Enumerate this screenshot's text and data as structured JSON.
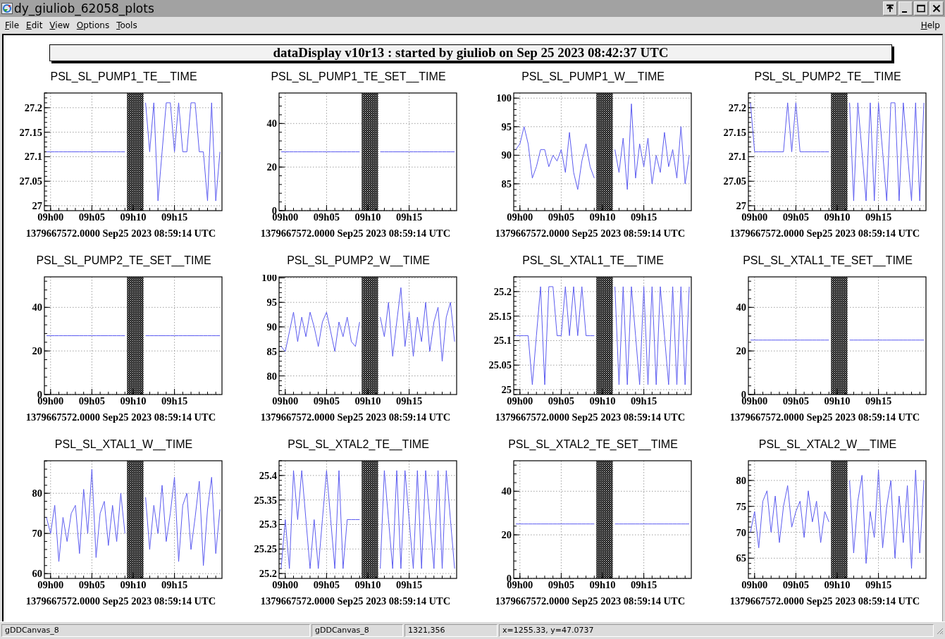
{
  "window": {
    "title": "dy_giuliob_62058_plots"
  },
  "menu": {
    "left": [
      "File",
      "Edit",
      "View",
      "Options",
      "Tools"
    ],
    "right": [
      "Help"
    ]
  },
  "header": "dataDisplay v10r13 : started by giuliob on Sep 25 2023 08:42:37 UTC",
  "plots": [
    {
      "chart_data": {
        "type": "line",
        "title": "PSL_SL_PUMP1_TE__TIME",
        "xlabel": "1379667572.0000 Sep25 2023 08:59:14 UTC",
        "ylim": [
          26.99,
          27.23
        ],
        "categories": [
          null,
          "09h00",
          null,
          null,
          null,
          null,
          null,
          null,
          null,
          null,
          null,
          "09h05",
          null,
          null,
          null,
          null,
          null,
          null,
          null,
          null,
          null,
          "09h10",
          null,
          null,
          null,
          null,
          null,
          null,
          null,
          null,
          null,
          "09h15",
          null,
          null,
          null,
          null,
          null,
          null,
          null,
          null,
          null,
          null,
          null
        ],
        "series": [
          {
            "color": "#5c5cf0",
            "values": [
              27.11,
              27.11,
              27.11,
              27.11,
              27.11,
              27.11,
              27.11,
              27.11,
              27.11,
              27.11,
              27.11,
              27.11,
              27.11,
              27.11,
              27.11,
              27.11,
              27.11,
              27.11,
              27.11,
              27.11,
              null,
              null,
              null,
              null,
              27.21,
              27.11,
              27.21,
              27.01,
              27.11,
              27.21,
              27.21,
              27.11,
              27.21,
              27.11,
              27.11,
              27.21,
              27.21,
              27.11,
              27.11,
              27.01,
              27.21,
              27.01,
              27.11
            ]
          }
        ],
        "yticks": [
          27,
          27.05,
          27.1,
          27.15,
          27.2
        ],
        "grid": true
      }
    },
    {
      "chart_data": {
        "type": "line",
        "title": "PSL_SL_PUMP1_TE_SET__TIME",
        "xlabel": "1379667572.0000 Sep25 2023 08:59:14 UTC",
        "ylim": [
          0,
          54
        ],
        "categories": [
          null,
          "09h00",
          null,
          null,
          null,
          null,
          null,
          null,
          null,
          null,
          null,
          "09h05",
          null,
          null,
          null,
          null,
          null,
          null,
          null,
          null,
          null,
          "09h10",
          null,
          null,
          null,
          null,
          null,
          null,
          null,
          null,
          null,
          "09h15",
          null,
          null,
          null,
          null,
          null,
          null,
          null,
          null,
          null,
          null,
          null
        ],
        "series": [
          {
            "color": "#5c5cf0",
            "values": [
              27,
              27,
              27,
              27,
              27,
              27,
              27,
              27,
              27,
              27,
              27,
              27,
              27,
              27,
              27,
              27,
              27,
              27,
              27,
              27,
              null,
              null,
              null,
              null,
              27,
              27,
              27,
              27,
              27,
              27,
              27,
              27,
              27,
              27,
              27,
              27,
              27,
              27,
              27,
              27,
              27,
              27,
              27
            ]
          }
        ],
        "yticks": [
          0,
          20,
          40
        ],
        "grid": true
      }
    },
    {
      "chart_data": {
        "type": "line",
        "title": "PSL_SL_PUMP1_W__TIME",
        "xlabel": "1379667572.0000 Sep25 2023 08:59:14 UTC",
        "ylim": [
          80.3,
          100.9
        ],
        "categories": [
          null,
          "09h00",
          null,
          null,
          null,
          null,
          null,
          null,
          null,
          null,
          null,
          "09h05",
          null,
          null,
          null,
          null,
          null,
          null,
          null,
          null,
          null,
          "09h10",
          null,
          null,
          null,
          null,
          null,
          null,
          null,
          null,
          null,
          "09h15",
          null,
          null,
          null,
          null,
          null,
          null,
          null,
          null,
          null,
          null,
          null
        ],
        "series": [
          {
            "color": "#5c5cf0",
            "values": [
              91,
              92,
              95,
              92,
              86,
              88,
              91,
              91,
              88,
              90,
              89,
              91,
              87,
              94,
              87,
              84,
              89,
              92,
              88,
              86,
              null,
              null,
              null,
              null,
              91,
              87,
              93,
              84,
              99,
              86,
              92,
              88,
              93,
              85,
              90,
              87,
              94,
              88,
              91,
              86,
              95,
              85,
              90
            ]
          }
        ],
        "yticks": [
          85,
          90,
          95,
          100
        ],
        "grid": true
      }
    },
    {
      "chart_data": {
        "type": "line",
        "title": "PSL_SL_PUMP2_TE__TIME",
        "xlabel": "1379667572.0000 Sep25 2023 08:59:14 UTC",
        "ylim": [
          26.99,
          27.23
        ],
        "categories": [
          null,
          "09h00",
          null,
          null,
          null,
          null,
          null,
          null,
          null,
          null,
          null,
          "09h05",
          null,
          null,
          null,
          null,
          null,
          null,
          null,
          null,
          null,
          "09h10",
          null,
          null,
          null,
          null,
          null,
          null,
          null,
          null,
          null,
          "09h15",
          null,
          null,
          null,
          null,
          null,
          null,
          null,
          null,
          null,
          null,
          null
        ],
        "series": [
          {
            "color": "#5c5cf0",
            "values": [
              27.21,
              27.11,
              27.11,
              27.11,
              27.11,
              27.11,
              27.11,
              27.11,
              27.11,
              27.21,
              27.11,
              27.21,
              27.11,
              27.11,
              27.11,
              27.11,
              27.11,
              27.11,
              27.11,
              27.11,
              null,
              null,
              null,
              null,
              27.21,
              27.01,
              27.21,
              27.11,
              27.01,
              27.21,
              27.01,
              27.21,
              27.11,
              27.01,
              27.21,
              27.21,
              27.01,
              27.21,
              27.11,
              27.01,
              27.21,
              27.01,
              27.21
            ]
          }
        ],
        "yticks": [
          27,
          27.05,
          27.1,
          27.15,
          27.2
        ],
        "grid": true
      }
    },
    {
      "chart_data": {
        "type": "line",
        "title": "PSL_SL_PUMP2_TE_SET__TIME",
        "xlabel": "1379667572.0000 Sep25 2023 08:59:14 UTC",
        "ylim": [
          0,
          54
        ],
        "categories": [
          null,
          "09h00",
          null,
          null,
          null,
          null,
          null,
          null,
          null,
          null,
          null,
          "09h05",
          null,
          null,
          null,
          null,
          null,
          null,
          null,
          null,
          null,
          "09h10",
          null,
          null,
          null,
          null,
          null,
          null,
          null,
          null,
          null,
          "09h15",
          null,
          null,
          null,
          null,
          null,
          null,
          null,
          null,
          null,
          null,
          null
        ],
        "series": [
          {
            "color": "#5c5cf0",
            "values": [
              27,
              27,
              27,
              27,
              27,
              27,
              27,
              27,
              27,
              27,
              27,
              27,
              27,
              27,
              27,
              27,
              27,
              27,
              27,
              27,
              null,
              null,
              null,
              null,
              27,
              27,
              27,
              27,
              27,
              27,
              27,
              27,
              27,
              27,
              27,
              27,
              27,
              27,
              27,
              27,
              27,
              27,
              27
            ]
          }
        ],
        "yticks": [
          0,
          20,
          40
        ],
        "grid": true
      }
    },
    {
      "chart_data": {
        "type": "line",
        "title": "PSL_SL_PUMP2_W__TIME",
        "xlabel": "1379667572.0000 Sep25 2023 08:59:14 UTC",
        "ylim": [
          76.2,
          100.2
        ],
        "categories": [
          null,
          "09h00",
          null,
          null,
          null,
          null,
          null,
          null,
          null,
          null,
          null,
          "09h05",
          null,
          null,
          null,
          null,
          null,
          null,
          null,
          null,
          null,
          "09h10",
          null,
          null,
          null,
          null,
          null,
          null,
          null,
          null,
          null,
          "09h15",
          null,
          null,
          null,
          null,
          null,
          null,
          null,
          null,
          null,
          null,
          null
        ],
        "series": [
          {
            "color": "#5c5cf0",
            "values": [
              86,
              85,
              89,
              93,
              87,
              92,
              88,
              93,
              90,
              86,
              91,
              93,
              89,
              85,
              91,
              88,
              92,
              87,
              86,
              91,
              null,
              null,
              null,
              null,
              92,
              88,
              95,
              84,
              91,
              98,
              86,
              93,
              84,
              92,
              87,
              95,
              85,
              91,
              94,
              83,
              92,
              95,
              87
            ]
          }
        ],
        "yticks": [
          80,
          85,
          90,
          95,
          100
        ],
        "grid": true
      }
    },
    {
      "chart_data": {
        "type": "line",
        "title": "PSL_SL_XTAL1_TE__TIME",
        "xlabel": "1379667572.0000 Sep25 2023 08:59:14 UTC",
        "ylim": [
          24.99,
          25.23
        ],
        "categories": [
          null,
          "09h00",
          null,
          null,
          null,
          null,
          null,
          null,
          null,
          null,
          null,
          "09h05",
          null,
          null,
          null,
          null,
          null,
          null,
          null,
          null,
          null,
          "09h10",
          null,
          null,
          null,
          null,
          null,
          null,
          null,
          null,
          null,
          "09h15",
          null,
          null,
          null,
          null,
          null,
          null,
          null,
          null,
          null,
          null,
          null
        ],
        "series": [
          {
            "color": "#5c5cf0",
            "values": [
              25.11,
              25.11,
              25.11,
              25.11,
              25.01,
              25.11,
              25.21,
              25.01,
              25.21,
              25.21,
              25.11,
              25.11,
              25.21,
              25.11,
              25.21,
              25.11,
              25.21,
              25.11,
              25.11,
              25.11,
              null,
              null,
              null,
              null,
              25.21,
              25.01,
              25.21,
              25.01,
              25.21,
              25.11,
              25.01,
              25.21,
              25.01,
              25.21,
              25.01,
              25.21,
              25.11,
              25.01,
              25.21,
              25.01,
              25.21,
              25.01,
              25.21
            ]
          }
        ],
        "yticks": [
          25,
          25.05,
          25.1,
          25.15,
          25.2
        ],
        "grid": true
      }
    },
    {
      "chart_data": {
        "type": "line",
        "title": "PSL_SL_XTAL1_TE_SET__TIME",
        "xlabel": "1379667572.0000 Sep25 2023 08:59:14 UTC",
        "ylim": [
          0,
          54
        ],
        "categories": [
          null,
          "09h00",
          null,
          null,
          null,
          null,
          null,
          null,
          null,
          null,
          null,
          "09h05",
          null,
          null,
          null,
          null,
          null,
          null,
          null,
          null,
          null,
          "09h10",
          null,
          null,
          null,
          null,
          null,
          null,
          null,
          null,
          null,
          "09h15",
          null,
          null,
          null,
          null,
          null,
          null,
          null,
          null,
          null,
          null,
          null
        ],
        "series": [
          {
            "color": "#5c5cf0",
            "values": [
              25,
              25,
              25,
              25,
              25,
              25,
              25,
              25,
              25,
              25,
              25,
              25,
              25,
              25,
              25,
              25,
              25,
              25,
              25,
              25,
              null,
              null,
              null,
              null,
              25,
              25,
              25,
              25,
              25,
              25,
              25,
              25,
              25,
              25,
              25,
              25,
              25,
              25,
              25,
              25,
              25,
              25,
              25
            ]
          }
        ],
        "yticks": [
          0,
          20,
          40
        ],
        "grid": true
      }
    },
    {
      "chart_data": {
        "type": "line",
        "title": "PSL_SL_XTAL1_W__TIME",
        "xlabel": "1379667572.0000 Sep25 2023 08:59:14 UTC",
        "ylim": [
          58.8,
          88.1
        ],
        "categories": [
          null,
          "09h00",
          null,
          null,
          null,
          null,
          null,
          null,
          null,
          null,
          null,
          "09h05",
          null,
          null,
          null,
          null,
          null,
          null,
          null,
          null,
          null,
          "09h10",
          null,
          null,
          null,
          null,
          null,
          null,
          null,
          null,
          null,
          "09h15",
          null,
          null,
          null,
          null,
          null,
          null,
          null,
          null,
          null,
          null,
          null
        ],
        "series": [
          {
            "color": "#5c5cf0",
            "values": [
              74,
              70,
              77,
              63,
              74,
              68,
              75,
              77,
              65,
              81,
              70,
              86,
              64,
              75,
              78,
              67,
              77,
              68,
              80,
              70,
              null,
              null,
              null,
              null,
              79,
              66,
              77,
              70,
              82,
              68,
              75,
              84,
              63,
              77,
              80,
              66,
              74,
              83,
              62,
              76,
              84,
              65,
              76
            ]
          }
        ],
        "yticks": [
          60,
          70,
          80
        ],
        "grid": true
      }
    },
    {
      "chart_data": {
        "type": "line",
        "title": "PSL_SL_XTAL2_TE__TIME",
        "xlabel": "1379667572.0000 Sep25 2023 08:59:14 UTC",
        "ylim": [
          25.19,
          25.43
        ],
        "categories": [
          null,
          "09h00",
          null,
          null,
          null,
          null,
          null,
          null,
          null,
          null,
          null,
          "09h05",
          null,
          null,
          null,
          null,
          null,
          null,
          null,
          null,
          null,
          "09h10",
          null,
          null,
          null,
          null,
          null,
          null,
          null,
          null,
          null,
          "09h15",
          null,
          null,
          null,
          null,
          null,
          null,
          null,
          null,
          null,
          null,
          null
        ],
        "series": [
          {
            "color": "#5c5cf0",
            "values": [
              25.21,
              25.31,
              25.21,
              25.41,
              25.31,
              25.41,
              25.31,
              25.21,
              25.31,
              25.21,
              25.31,
              25.41,
              25.31,
              25.21,
              25.41,
              25.21,
              25.31,
              25.31,
              25.31,
              25.31,
              null,
              null,
              null,
              null,
              25.21,
              25.41,
              25.31,
              25.21,
              25.41,
              25.21,
              25.41,
              25.31,
              25.21,
              25.41,
              25.21,
              25.41,
              25.31,
              25.21,
              25.41,
              25.21,
              25.41,
              25.31,
              25.21
            ]
          }
        ],
        "yticks": [
          25.2,
          25.25,
          25.3,
          25.35,
          25.4
        ],
        "grid": true
      }
    },
    {
      "chart_data": {
        "type": "line",
        "title": "PSL_SL_XTAL2_TE_SET__TIME",
        "xlabel": "1379667572.0000 Sep25 2023 08:59:14 UTC",
        "ylim": [
          0,
          54
        ],
        "categories": [
          null,
          "09h00",
          null,
          null,
          null,
          null,
          null,
          null,
          null,
          null,
          null,
          "09h05",
          null,
          null,
          null,
          null,
          null,
          null,
          null,
          null,
          null,
          "09h10",
          null,
          null,
          null,
          null,
          null,
          null,
          null,
          null,
          null,
          "09h15",
          null,
          null,
          null,
          null,
          null,
          null,
          null,
          null,
          null,
          null,
          null
        ],
        "series": [
          {
            "color": "#5c5cf0",
            "values": [
              25,
              25,
              25,
              25,
              25,
              25,
              25,
              25,
              25,
              25,
              25,
              25,
              25,
              25,
              25,
              25,
              25,
              25,
              25,
              25,
              null,
              null,
              null,
              null,
              25,
              25,
              25,
              25,
              25,
              25,
              25,
              25,
              25,
              25,
              25,
              25,
              25,
              25,
              25,
              25,
              25,
              25,
              25
            ]
          }
        ],
        "yticks": [
          0,
          20,
          40
        ],
        "grid": true
      }
    },
    {
      "chart_data": {
        "type": "line",
        "title": "PSL_SL_XTAL2_W__TIME",
        "xlabel": "1379667572.0000 Sep25 2023 08:59:14 UTC",
        "ylim": [
          61.1,
          83.8
        ],
        "categories": [
          null,
          "09h00",
          null,
          null,
          null,
          null,
          null,
          null,
          null,
          null,
          null,
          "09h05",
          null,
          null,
          null,
          null,
          null,
          null,
          null,
          null,
          null,
          "09h10",
          null,
          null,
          null,
          null,
          null,
          null,
          null,
          null,
          null,
          "09h15",
          null,
          null,
          null,
          null,
          null,
          null,
          null,
          null,
          null,
          null,
          null
        ],
        "series": [
          {
            "color": "#5c5cf0",
            "values": [
              70,
              74,
              67,
              76,
              78,
              70,
              77,
              68,
              75,
              79,
              71,
              74,
              76,
              69,
              78,
              72,
              76,
              68,
              74,
              72,
              null,
              null,
              null,
              null,
              80,
              66,
              76,
              81,
              64,
              74,
              69,
              82,
              67,
              75,
              80,
              65,
              77,
              68,
              79,
              63,
              82,
              66,
              80
            ]
          }
        ],
        "yticks": [
          65,
          70,
          75,
          80
        ],
        "grid": true
      }
    }
  ],
  "status_bar": [
    "gDDCanvas_8",
    "gDDCanvas_8",
    "1321,356",
    "x=1255.33, y=47.0737"
  ]
}
